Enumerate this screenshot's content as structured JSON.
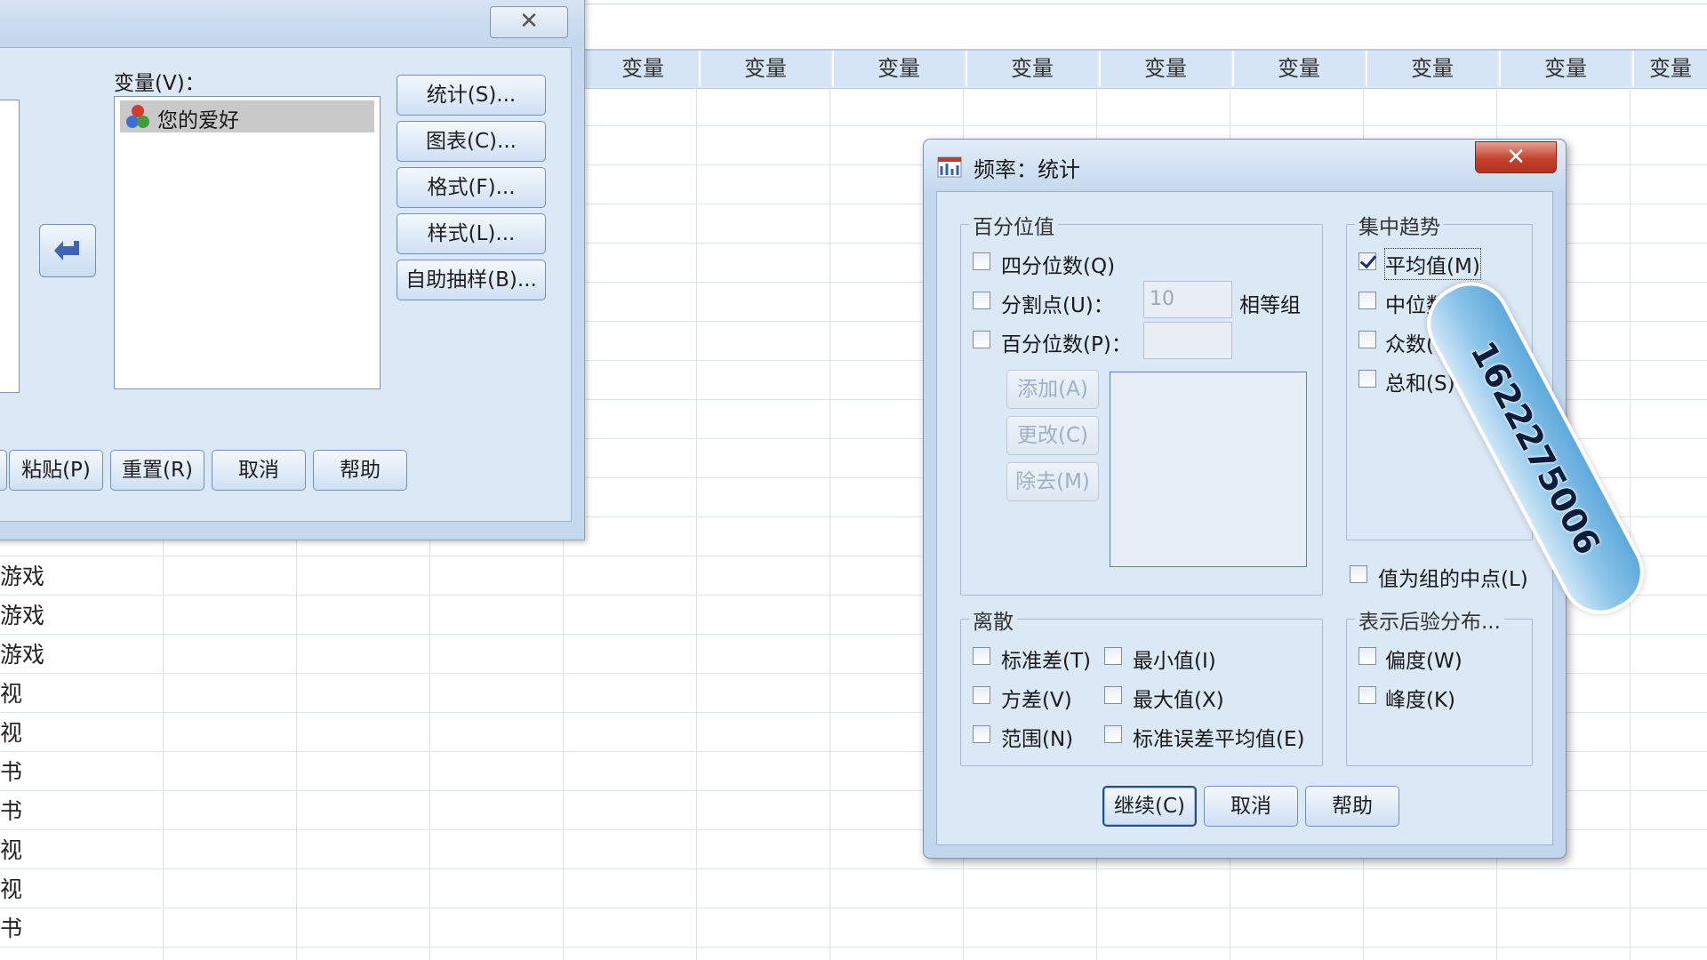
{
  "grid": {
    "column_header": "变量",
    "row_values": [
      "游戏",
      "游戏",
      "游戏",
      "视",
      "视",
      "书",
      "书",
      "视",
      "视",
      "书"
    ]
  },
  "frequencies_dialog": {
    "variables_label": "变量(V)：",
    "variable_items": [
      "您的爱好"
    ],
    "side_buttons": [
      "统计(S)...",
      "图表(C)...",
      "格式(F)...",
      "样式(L)...",
      "自助抽样(B)..."
    ],
    "bottom_buttons": [
      "粘贴(P)",
      "重置(R)",
      "取消",
      "帮助"
    ],
    "close_glyph": "✕"
  },
  "statistics_dialog": {
    "title": "频率：统计",
    "close_glyph": "✕",
    "percentile_group": {
      "title": "百分位值",
      "quartiles": {
        "label": "四分位数(Q)",
        "checked": false
      },
      "cut_points": {
        "label": "分割点(U)：",
        "checked": false,
        "value": "10",
        "suffix": "相等组"
      },
      "percentiles": {
        "label": "百分位数(P)：",
        "checked": false,
        "value": ""
      },
      "buttons": [
        "添加(A)",
        "更改(C)",
        "除去(M)"
      ]
    },
    "central_tendency_group": {
      "title": "集中趋势",
      "items": [
        {
          "label": "平均值(M)",
          "checked": true
        },
        {
          "label": "中位数",
          "checked": false
        },
        {
          "label": "众数(O)",
          "checked": false
        },
        {
          "label": "总和(S)",
          "checked": false
        }
      ]
    },
    "group_midpoints": {
      "label": "值为组的中点(L)",
      "checked": false
    },
    "dispersion_group": {
      "title": "离散",
      "items": [
        {
          "label": "标准差(T)",
          "checked": false
        },
        {
          "label": "最小值(I)",
          "checked": false
        },
        {
          "label": "方差(V)",
          "checked": false
        },
        {
          "label": "最大值(X)",
          "checked": false
        },
        {
          "label": "范围(N)",
          "checked": false
        },
        {
          "label": "标准误差平均值(E)",
          "checked": false
        }
      ]
    },
    "distribution_group": {
      "title": "表示后验分布...",
      "items": [
        {
          "label": "偏度(W)",
          "checked": false
        },
        {
          "label": "峰度(K)",
          "checked": false
        }
      ]
    },
    "footer_buttons": [
      "继续(C)",
      "取消",
      "帮助"
    ]
  },
  "watermark": {
    "text": "1622275006"
  },
  "colors": {
    "accent": "#2b4e7f",
    "close_red": "#c4422f",
    "panel": "#dbe8f6"
  }
}
